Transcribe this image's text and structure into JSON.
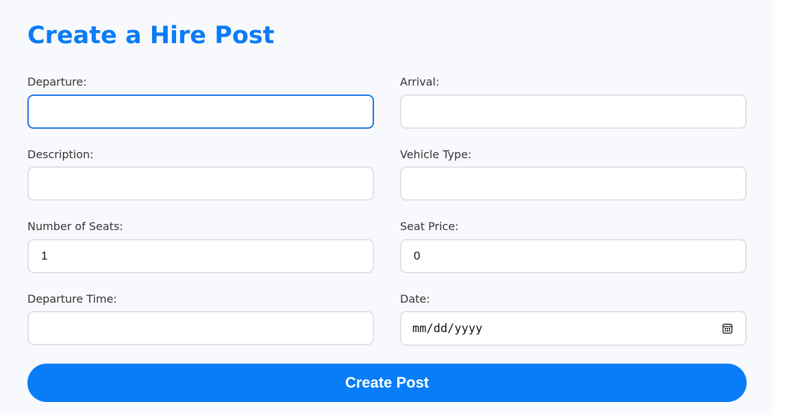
{
  "title": "Create a Hire Post",
  "fields": {
    "departure": {
      "label": "Departure:",
      "value": ""
    },
    "arrival": {
      "label": "Arrival:",
      "value": ""
    },
    "description": {
      "label": "Description:",
      "value": ""
    },
    "vehicle_type": {
      "label": "Vehicle Type:",
      "value": ""
    },
    "seats": {
      "label": "Number of Seats:",
      "value": "1"
    },
    "seat_price": {
      "label": "Seat Price:",
      "value": "0"
    },
    "departure_time": {
      "label": "Departure Time:",
      "value": ""
    },
    "date": {
      "label": "Date:",
      "placeholder": "mm/dd/yyyy",
      "icon": "calendar-icon"
    }
  },
  "submit_label": "Create Post",
  "colors": {
    "accent": "#087df7",
    "title": "#0a7cf7",
    "focus_border": "#1a73e8"
  }
}
